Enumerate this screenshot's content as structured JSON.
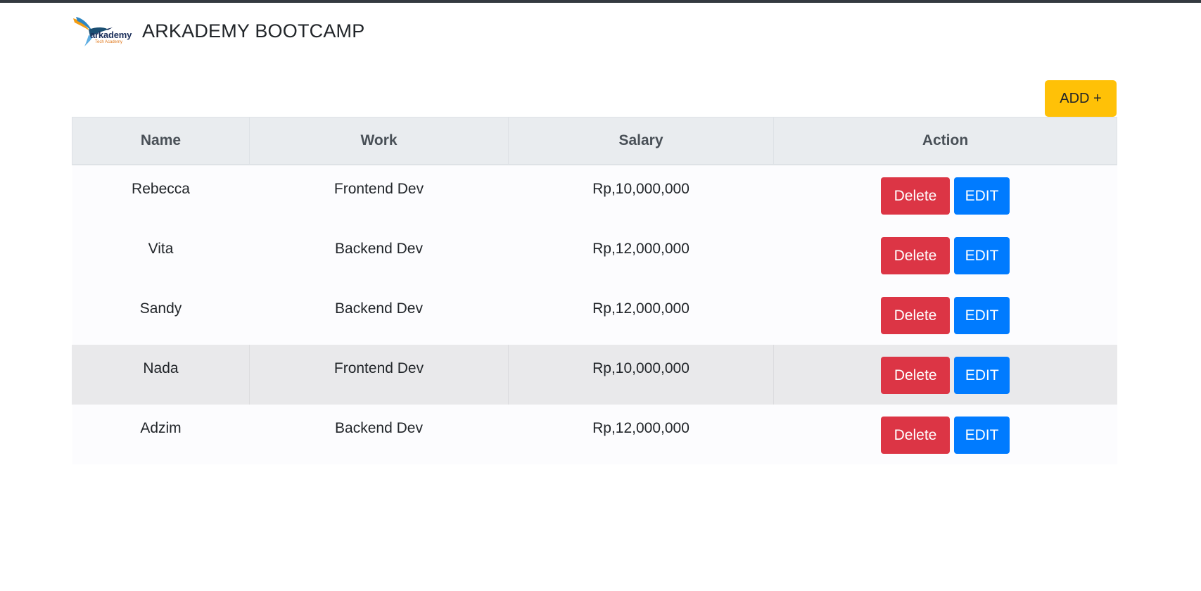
{
  "header": {
    "brand_title": "ARKADEMY BOOTCAMP",
    "logo": {
      "word": "arkademy",
      "sub": "Tech Academy"
    }
  },
  "toolbar": {
    "add_label": "ADD +"
  },
  "table": {
    "columns": [
      "Name",
      "Work",
      "Salary",
      "Action"
    ],
    "rows": [
      {
        "name": "Rebecca",
        "work": "Frontend Dev",
        "salary": "Rp,10,000,000",
        "delete_label": "Delete",
        "edit_label": "EDIT"
      },
      {
        "name": "Vita",
        "work": "Backend Dev",
        "salary": "Rp,12,000,000",
        "delete_label": "Delete",
        "edit_label": "EDIT"
      },
      {
        "name": "Sandy",
        "work": "Backend Dev",
        "salary": "Rp,12,000,000",
        "delete_label": "Delete",
        "edit_label": "EDIT"
      },
      {
        "name": "Nada",
        "work": "Frontend Dev",
        "salary": "Rp,10,000,000",
        "delete_label": "Delete",
        "edit_label": "EDIT"
      },
      {
        "name": "Adzim",
        "work": "Backend Dev",
        "salary": "Rp,12,000,000",
        "delete_label": "Delete",
        "edit_label": "EDIT"
      }
    ],
    "hovered_row_index": 3
  },
  "colors": {
    "add_button": "#ffc107",
    "delete_button": "#dc3545",
    "edit_button": "#007bff",
    "header_bg": "#e9ecef"
  },
  "icons": {
    "logo": "hummingbird-logo-icon"
  }
}
